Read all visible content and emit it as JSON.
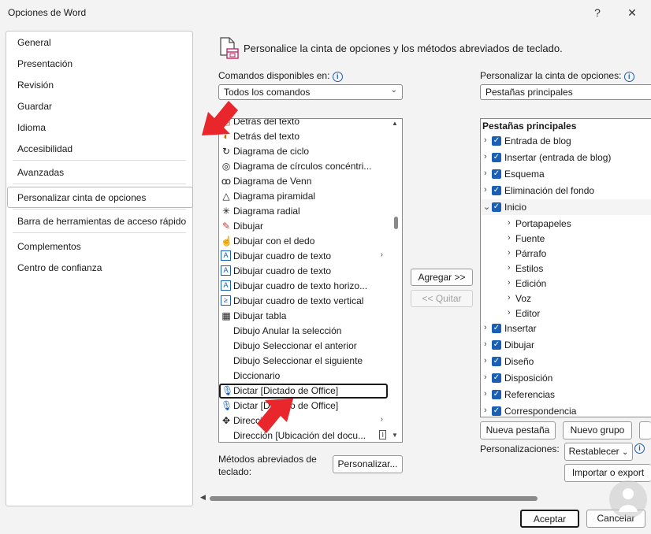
{
  "window": {
    "title": "Opciones de Word",
    "help_glyph": "?",
    "close_glyph": "✕"
  },
  "nav": {
    "items": [
      {
        "label": "General"
      },
      {
        "label": "Presentación"
      },
      {
        "label": "Revisión"
      },
      {
        "label": "Guardar"
      },
      {
        "label": "Idioma"
      },
      {
        "label": "Accesibilidad"
      },
      {
        "label": "Avanzadas"
      },
      {
        "label": "Personalizar cinta de opciones"
      },
      {
        "label": "Barra de herramientas de acceso rápido"
      },
      {
        "label": "Complementos"
      },
      {
        "label": "Centro de confianza"
      }
    ],
    "selected": "Personalizar cinta de opciones"
  },
  "header": {
    "text": "Personalice la cinta de opciones y los métodos abreviados de teclado."
  },
  "commands": {
    "label": "Comandos disponibles en:",
    "selected": "Todos los comandos",
    "items": [
      {
        "label": "Detrás del texto",
        "icon": "wrap-behind-icon"
      },
      {
        "label": "Detrás del texto",
        "icon": "wrap-behind-icon"
      },
      {
        "label": "Diagrama de ciclo",
        "icon": "cycle-icon"
      },
      {
        "label": "Diagrama de círculos concéntri...",
        "icon": "target-icon"
      },
      {
        "label": "Diagrama de Venn",
        "icon": "venn-icon"
      },
      {
        "label": "Diagrama piramidal",
        "icon": "pyramid-icon"
      },
      {
        "label": "Diagrama radial",
        "icon": "radial-icon"
      },
      {
        "label": "Dibujar",
        "icon": "draw-icon"
      },
      {
        "label": "Dibujar con el dedo",
        "icon": "finger-icon"
      },
      {
        "label": "Dibujar cuadro de texto",
        "icon": "textbox-icon",
        "submenu": true
      },
      {
        "label": "Dibujar cuadro de texto",
        "icon": "textbox-icon"
      },
      {
        "label": "Dibujar cuadro de texto horizo...",
        "icon": "textbox-icon"
      },
      {
        "label": "Dibujar cuadro de texto vertical",
        "icon": "vertical-textbox-icon"
      },
      {
        "label": "Dibujar tabla",
        "icon": "table-pencil-icon"
      },
      {
        "label": "Dibujo Anular la selección",
        "icon": ""
      },
      {
        "label": "Dibujo Seleccionar el anterior",
        "icon": ""
      },
      {
        "label": "Dibujo Seleccionar el siguiente",
        "icon": ""
      },
      {
        "label": "Diccionario",
        "icon": ""
      },
      {
        "label": "Dictar [Dictado de Office]",
        "icon": "microphone-icon",
        "selected": true
      },
      {
        "label": "Dictar [Dictado de Office]",
        "icon": "microphone-icon"
      },
      {
        "label": "Dirección",
        "icon": "move-icon",
        "submenu": true
      },
      {
        "label": "Dirección [Ubicación del docu...",
        "icon": ""
      }
    ]
  },
  "buttons": {
    "add": "Agregar >>",
    "remove": "<< Quitar",
    "new_tab": "Nueva pestaña",
    "new_group": "Nuevo grupo",
    "reset": "Restablecer",
    "import_export": "Importar o export",
    "customize": "Personalizar...",
    "ok": "Aceptar",
    "cancel": "Cancelar"
  },
  "ribbon": {
    "label": "Personalizar la cinta de opciones:",
    "selected": "Pestañas principales",
    "tree_header": "Pestañas principales",
    "tree": [
      {
        "label": "Entrada de blog",
        "level": 0,
        "checked": true,
        "expanded": false
      },
      {
        "label": "Insertar (entrada de blog)",
        "level": 0,
        "checked": true,
        "expanded": false
      },
      {
        "label": "Esquema",
        "level": 0,
        "checked": true,
        "expanded": false
      },
      {
        "label": "Eliminación del fondo",
        "level": 0,
        "checked": true,
        "expanded": false
      },
      {
        "label": "Inicio",
        "level": 0,
        "checked": true,
        "expanded": true
      },
      {
        "label": "Portapapeles",
        "level": 1
      },
      {
        "label": "Fuente",
        "level": 1
      },
      {
        "label": "Párrafo",
        "level": 1
      },
      {
        "label": "Estilos",
        "level": 1
      },
      {
        "label": "Edición",
        "level": 1
      },
      {
        "label": "Voz",
        "level": 1
      },
      {
        "label": "Editor",
        "level": 1
      },
      {
        "label": "Insertar",
        "level": 0,
        "checked": true,
        "expanded": false
      },
      {
        "label": "Dibujar",
        "level": 0,
        "checked": true,
        "expanded": false
      },
      {
        "label": "Diseño",
        "level": 0,
        "checked": true,
        "expanded": false
      },
      {
        "label": "Disposición",
        "level": 0,
        "checked": true,
        "expanded": false
      },
      {
        "label": "Referencias",
        "level": 0,
        "checked": true,
        "expanded": false
      },
      {
        "label": "Correspondencia",
        "level": 0,
        "checked": true,
        "expanded": false
      }
    ]
  },
  "shortcuts": {
    "label_line1": "Métodos abreviados de",
    "label_line2": "teclado:"
  },
  "customizations_label": "Personalizaciones:",
  "colors": {
    "accent": "#1a5fb4",
    "annotation_arrow": "#e8262b"
  }
}
